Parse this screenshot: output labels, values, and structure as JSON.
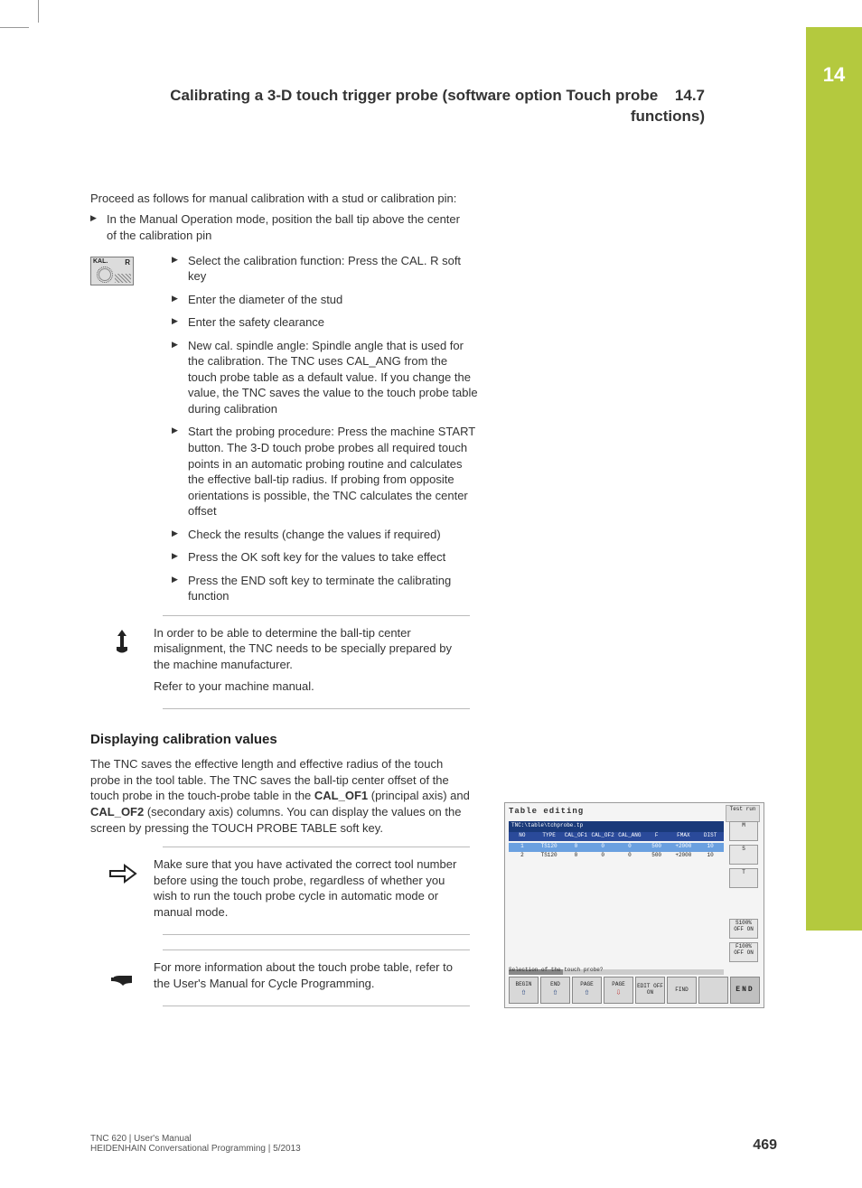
{
  "chapter_tab": "14",
  "running_head": {
    "title_line1": "Calibrating a 3-D touch trigger probe (software option Touch probe",
    "title_line2": "functions)",
    "section": "14.7"
  },
  "intro": "Proceed as follows for manual calibration with a stud or calibration pin:",
  "step_manual": "In the Manual Operation mode, position the ball tip above the center of the calibration pin",
  "softkey_cal": {
    "label": "KAL.",
    "r": "R"
  },
  "steps": [
    "Select the calibration function: Press the CAL. R soft key",
    "Enter the diameter of the stud",
    "Enter the safety clearance",
    "New cal. spindle angle: Spindle angle that is used for the calibration. The TNC uses CAL_ANG from the touch probe table as a default value. If you change the value, the TNC saves the value to the touch probe table during calibration",
    "Start the probing procedure: Press the machine START button. The 3-D touch probe probes all required touch points in an automatic probing routine and calculates the effective ball-tip radius. If probing from opposite orientations is possible, the TNC calculates the center offset",
    "Check the results (change the values if required)",
    "Press the OK soft key for the values to take effect",
    "Press the END soft key to terminate the calibrating function"
  ],
  "note_probe": {
    "p1": "In order to be able to determine the ball-tip center misalignment, the TNC needs to be specially prepared by the machine manufacturer.",
    "p2": "Refer to your machine manual."
  },
  "section2_title": "Displaying calibration values",
  "section2_body_pre": "The TNC saves the effective length and effective radius of the touch probe in the tool table. The TNC saves the ball-tip center offset of the touch probe in the touch-probe table in the ",
  "cal_of1": "CAL_OF1",
  "section2_body_mid": " (principal axis) and ",
  "cal_of2": "CAL_OF2",
  "section2_body_post": " (secondary axis) columns. You can display the values on the screen by pressing the TOUCH PROBE TABLE soft key.",
  "note_arrow": "Make sure that you have activated the correct tool number before using the touch probe, regardless of whether you wish to run the touch probe cycle in automatic mode or manual mode.",
  "note_book": "For more information about the touch probe table, refer to the User's Manual for Cycle Programming.",
  "screenshot": {
    "title": "Table editing",
    "mini": "Test run",
    "path": "TNC:\\table\\tchprobe.tp",
    "headers": [
      "NO",
      "TYPE",
      "CAL_OF1",
      "CAL_OF2",
      "CAL_ANG",
      "F",
      "FMAX",
      "DIST"
    ],
    "rows": [
      [
        "1",
        "TS120",
        "0",
        "0",
        "0",
        "500",
        "+2000",
        "10"
      ],
      [
        "2",
        "TS120",
        "0",
        "0",
        "0",
        "500",
        "+2000",
        "10"
      ]
    ],
    "right_buttons": [
      "M",
      "S",
      "T"
    ],
    "right_toggle1": {
      "label": "S100%",
      "off": "OFF",
      "on": "ON"
    },
    "right_toggle2": {
      "label": "F100%",
      "off": "OFF",
      "on": "ON"
    },
    "status": "Selection of the touch probe?",
    "softkeys": [
      "BEGIN",
      "END",
      "PAGE",
      "PAGE",
      "EDIT OFF ON",
      "FIND",
      "",
      "END"
    ]
  },
  "footer": {
    "line1": "TNC 620 | User's Manual",
    "line2": "HEIDENHAIN Conversational Programming | 5/2013",
    "page": "469"
  }
}
